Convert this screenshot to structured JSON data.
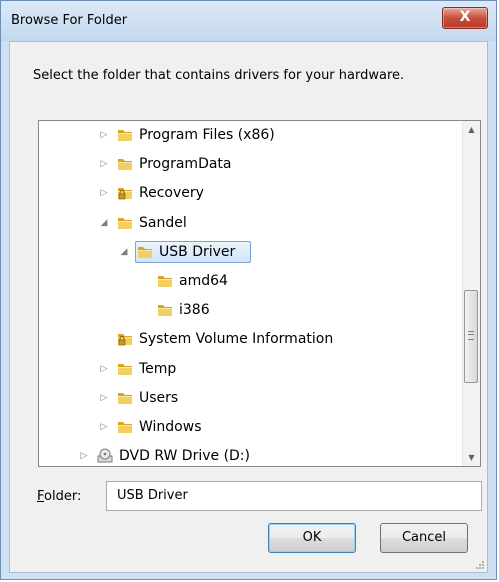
{
  "window": {
    "title": "Browse For Folder",
    "close_glyph": "X"
  },
  "instruction": "Select the folder that contains drivers for your hardware.",
  "tree": {
    "items": [
      {
        "label": "Program Files (x86)",
        "expander": "▷",
        "icon": "folder-icon"
      },
      {
        "label": "ProgramData",
        "expander": "▷",
        "icon": "folder-icon"
      },
      {
        "label": "Recovery",
        "expander": "▷",
        "icon": "locked-folder-icon"
      },
      {
        "label": "Sandel",
        "expander": "◢",
        "icon": "folder-icon"
      },
      {
        "label": "USB Driver",
        "expander": "◢",
        "icon": "folder-icon",
        "selected": true
      },
      {
        "label": "amd64",
        "expander": "",
        "icon": "folder-icon"
      },
      {
        "label": "i386",
        "expander": "",
        "icon": "folder-icon"
      },
      {
        "label": "System Volume Information",
        "expander": "",
        "icon": "locked-folder-icon"
      },
      {
        "label": "Temp",
        "expander": "▷",
        "icon": "folder-icon"
      },
      {
        "label": "Users",
        "expander": "▷",
        "icon": "folder-icon"
      },
      {
        "label": "Windows",
        "expander": "▷",
        "icon": "folder-icon"
      },
      {
        "label": "DVD RW Drive (D:)",
        "expander": "▷",
        "icon": "dvd-drive-icon"
      }
    ]
  },
  "scrollbar": {
    "up_glyph": "▲",
    "down_glyph": "▼",
    "position_fraction": 0.55
  },
  "folder_field": {
    "label": "Folder:",
    "value": "USB Driver"
  },
  "buttons": {
    "ok": "OK",
    "cancel": "Cancel"
  },
  "colors": {
    "selection": "#cfe4fb",
    "folder": "#e8b93c",
    "close": "#c8503b"
  }
}
